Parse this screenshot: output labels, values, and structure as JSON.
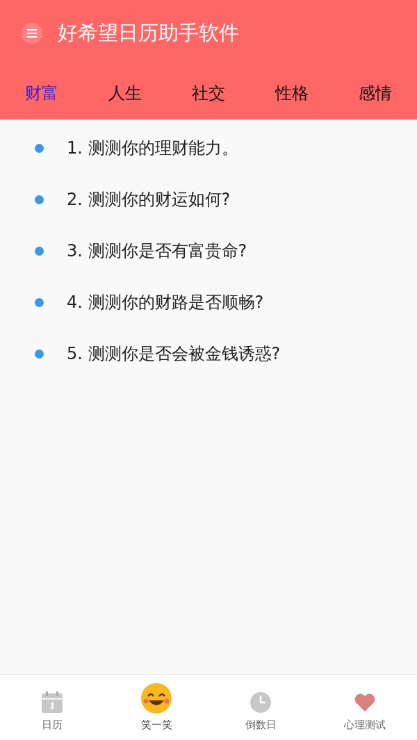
{
  "app_bar": {
    "title": "好希望日历助手软件"
  },
  "tabs": [
    {
      "label": "财富",
      "selected": true
    },
    {
      "label": "人生",
      "selected": false
    },
    {
      "label": "社交",
      "selected": false
    },
    {
      "label": "性格",
      "selected": false
    },
    {
      "label": "感情",
      "selected": false
    }
  ],
  "questions": [
    "1. 测测你的理财能力。",
    "2. 测测你的财运如何?",
    "3. 测测你是否有富贵命?",
    "4. 测测你的财路是否顺畅?",
    "5. 测测你是否会被金钱诱惑?"
  ],
  "bottom_nav": [
    {
      "kind": "calendar",
      "label": "日历",
      "selected": false
    },
    {
      "kind": "smile",
      "label": "笑一笑",
      "selected": true
    },
    {
      "kind": "countdown",
      "label": "倒数日",
      "selected": false
    },
    {
      "kind": "test",
      "label": "心理测试",
      "selected": false
    }
  ]
}
